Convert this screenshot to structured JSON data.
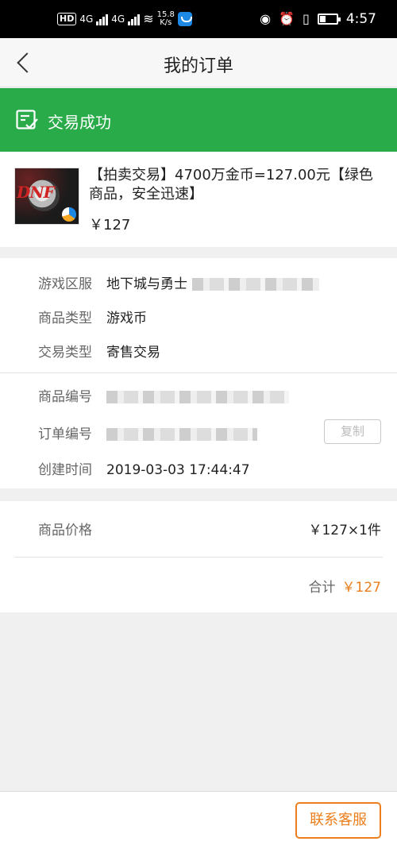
{
  "status_bar": {
    "net_speed_value": "15.8",
    "net_speed_unit": "K/s",
    "time": "4:57",
    "hd": "HD",
    "network_1": "4G",
    "network_2": "4G"
  },
  "navbar": {
    "title": "我的订单"
  },
  "banner": {
    "status": "交易成功",
    "color": "#2aab4a"
  },
  "product": {
    "title": "【拍卖交易】4700万金币=127.00元【绿色商品，安全迅速】",
    "price": "￥127"
  },
  "order_info": {
    "game_server": {
      "label": "游戏区服",
      "value": "地下城与勇士"
    },
    "item_type": {
      "label": "商品类型",
      "value": "游戏币"
    },
    "trade_type": {
      "label": "交易类型",
      "value": "寄售交易"
    },
    "item_no": {
      "label": "商品编号"
    },
    "order_no": {
      "label": "订单编号"
    },
    "copy_button": "复制",
    "created_at": {
      "label": "创建时间",
      "value": "2019-03-03 17:44:47"
    }
  },
  "price_summary": {
    "label": "商品价格",
    "unit_qty": "￥127×1件",
    "total_label": "合计",
    "total_value": "￥127",
    "accent": "#ec7f1c"
  },
  "footer": {
    "contact_button": "联系客服"
  }
}
